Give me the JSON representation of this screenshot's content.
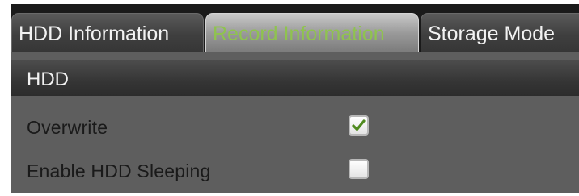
{
  "tabs": [
    {
      "label": "HDD Information",
      "active": false
    },
    {
      "label": "Record Information",
      "active": true
    },
    {
      "label": "Storage Mode",
      "active": false
    }
  ],
  "section": {
    "title": "HDD"
  },
  "settings": {
    "overwrite": {
      "label": "Overwrite",
      "checked": true
    },
    "enable_hdd_sleeping": {
      "label": "Enable HDD Sleeping",
      "checked": false
    }
  },
  "colors": {
    "active_tab_text": "#8fc34f",
    "checkmark": "#4f8a1e",
    "panel_background": "#5e5e5e"
  },
  "icons": {
    "checkmark": "checkmark-icon"
  }
}
